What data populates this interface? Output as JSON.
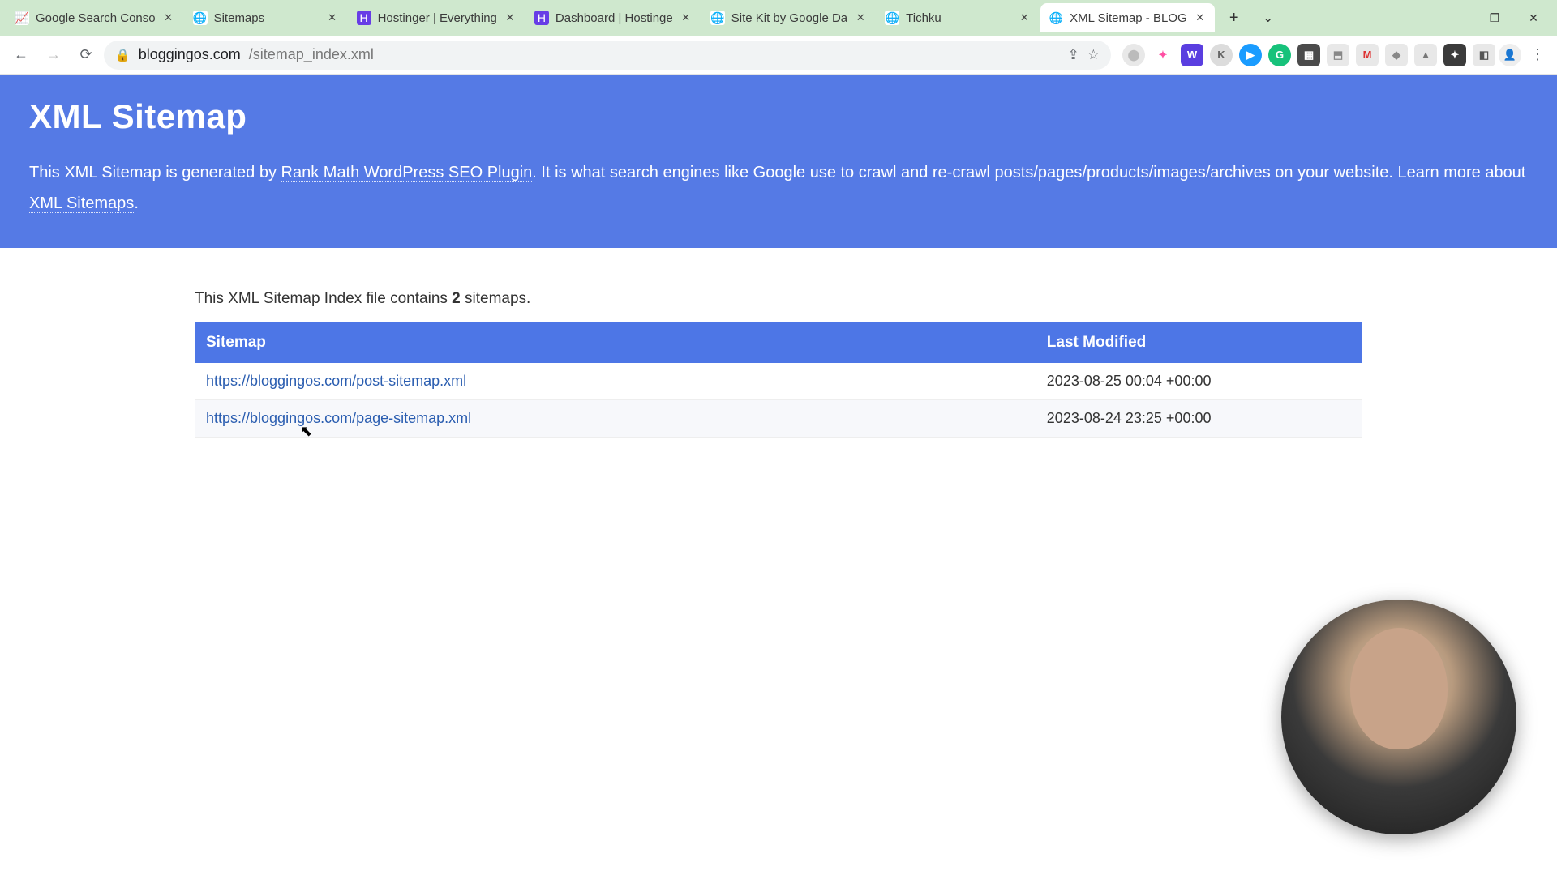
{
  "window": {
    "tabs": [
      {
        "title": "Google Search Conso",
        "favicon": "📈",
        "faviconBg": "#fff",
        "faviconColor": "#4285f4"
      },
      {
        "title": "Sitemaps",
        "favicon": "🌐",
        "faviconBg": "#fff",
        "faviconColor": "#555"
      },
      {
        "title": "Hostinger | Everything",
        "favicon": "H",
        "faviconBg": "#673de6",
        "faviconColor": "#fff"
      },
      {
        "title": "Dashboard | Hostinge",
        "favicon": "H",
        "faviconBg": "#673de6",
        "faviconColor": "#fff"
      },
      {
        "title": "Site Kit by Google Da",
        "favicon": "🌐",
        "faviconBg": "#fff",
        "faviconColor": "#555"
      },
      {
        "title": "Tichku",
        "favicon": "🌐",
        "faviconBg": "#fff",
        "faviconColor": "#555"
      },
      {
        "title": "XML Sitemap - BLOG",
        "favicon": "🌐",
        "faviconBg": "#fff",
        "faviconColor": "#555",
        "active": true
      }
    ],
    "newTabLabel": "+",
    "dropdown": "⌄",
    "controls": {
      "min": "—",
      "max": "❐",
      "close": "✕"
    }
  },
  "toolbar": {
    "back": "←",
    "forward": "→",
    "reload": "⟳",
    "lock": "🔒",
    "url_host": "bloggingos.com",
    "url_path": "/sitemap_index.xml",
    "share": "⇪",
    "star": "☆"
  },
  "extensions": [
    {
      "glyph": "⬤",
      "bg": "#e8e8e8",
      "color": "#bbb"
    },
    {
      "glyph": "✦",
      "bg": "#ffffff",
      "color": "#ff4fa3"
    },
    {
      "glyph": "W",
      "bg": "#5a3ee0",
      "color": "#fff",
      "square": true
    },
    {
      "glyph": "K",
      "bg": "#dcdcdc",
      "color": "#666"
    },
    {
      "glyph": "▶",
      "bg": "#1a9cff",
      "color": "#fff"
    },
    {
      "glyph": "G",
      "bg": "#17c27b",
      "color": "#fff"
    },
    {
      "glyph": "▦",
      "bg": "#4b4b4b",
      "color": "#fff",
      "square": true
    },
    {
      "glyph": "⬒",
      "bg": "#e8e8e8",
      "color": "#888",
      "square": true
    },
    {
      "glyph": "M",
      "bg": "#e8e8e8",
      "color": "#d33",
      "square": true
    },
    {
      "glyph": "◆",
      "bg": "#e8e8e8",
      "color": "#888",
      "square": true
    },
    {
      "glyph": "▲",
      "bg": "#e8e8e8",
      "color": "#777",
      "square": true
    },
    {
      "glyph": "✦",
      "bg": "#3b3b3b",
      "color": "#fff",
      "square": true
    },
    {
      "glyph": "◧",
      "bg": "#e8e8e8",
      "color": "#555",
      "square": true
    }
  ],
  "profile": {
    "glyph": "👤"
  },
  "menu": {
    "glyph": "⋮"
  },
  "page": {
    "title": "XML Sitemap",
    "intro_prefix": "This XML Sitemap is generated by ",
    "intro_link1": "Rank Math WordPress SEO Plugin",
    "intro_mid": ". It is what search engines like Google use to crawl and re-crawl posts/pages/products/images/archives on your website. Learn more about ",
    "intro_link2": "XML Sitemaps",
    "intro_suffix": ".",
    "count_prefix": "This XML Sitemap Index file contains ",
    "count_value": "2",
    "count_suffix": " sitemaps.",
    "columns": {
      "sitemap": "Sitemap",
      "modified": "Last Modified"
    },
    "rows": [
      {
        "url": "https://bloggingos.com/post-sitemap.xml",
        "modified": "2023-08-25 00:04 +00:00"
      },
      {
        "url": "https://bloggingos.com/page-sitemap.xml",
        "modified": "2023-08-24 23:25 +00:00"
      }
    ]
  }
}
